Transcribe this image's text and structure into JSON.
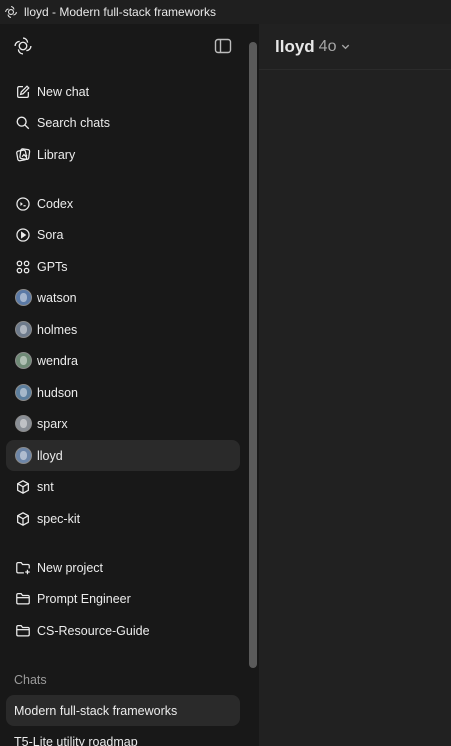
{
  "window": {
    "title": "lloyd - Modern full-stack frameworks"
  },
  "sidebar": {
    "actions": [
      {
        "label": "New chat",
        "icon": "new-chat-icon"
      },
      {
        "label": "Search chats",
        "icon": "search-icon"
      },
      {
        "label": "Library",
        "icon": "library-icon"
      }
    ],
    "apps": [
      {
        "label": "Codex",
        "icon": "codex-icon"
      },
      {
        "label": "Sora",
        "icon": "play-icon"
      },
      {
        "label": "GPTs",
        "icon": "grid-icon"
      }
    ],
    "gpts": [
      {
        "label": "watson",
        "avatar_color": "#5b7aa6"
      },
      {
        "label": "holmes",
        "avatar_color": "#6e7b8c"
      },
      {
        "label": "wendra",
        "avatar_color": "#6f8a76"
      },
      {
        "label": "hudson",
        "avatar_color": "#5d7f9e"
      },
      {
        "label": "sparx",
        "avatar_color": "#8a8f96"
      },
      {
        "label": "lloyd",
        "avatar_color": "#6d86a8"
      }
    ],
    "custom": [
      {
        "label": "snt",
        "icon": "cube-icon"
      },
      {
        "label": "spec-kit",
        "icon": "cube-icon"
      }
    ],
    "projects": [
      {
        "label": "New project",
        "icon": "folder-plus-icon"
      },
      {
        "label": "Prompt Engineer",
        "icon": "folder-icon"
      },
      {
        "label": "CS-Resource-Guide",
        "icon": "folder-icon"
      }
    ],
    "chats_heading": "Chats",
    "chats": [
      {
        "label": "Modern full-stack frameworks"
      },
      {
        "label": "T5-Lite utility roadmap"
      }
    ]
  },
  "main": {
    "model_name": "lloyd",
    "model_version": "4o"
  },
  "colors": {
    "sidebar_bg": "#181818",
    "main_bg": "#212121",
    "active_bg": "#2a2a2a",
    "text": "#ececec",
    "muted": "#9b9b9b"
  }
}
